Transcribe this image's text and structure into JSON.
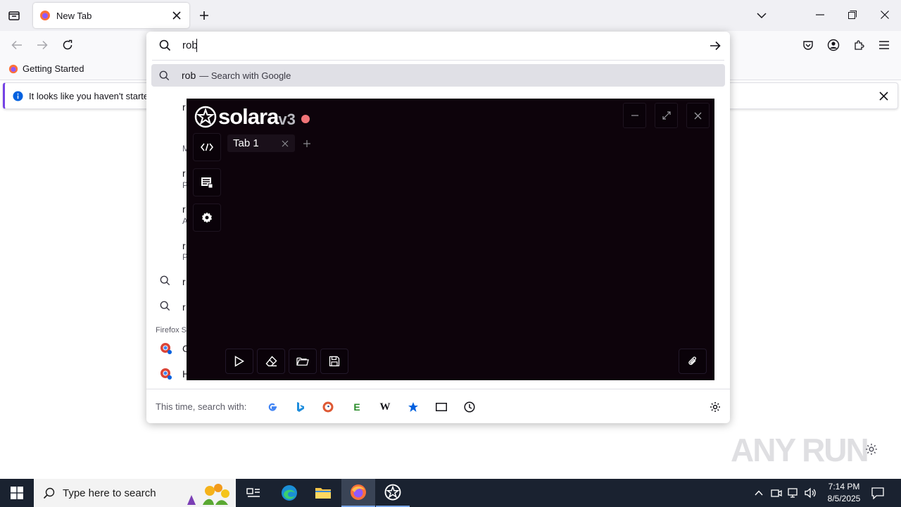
{
  "browser": {
    "tab_title": "New Tab",
    "bookmark_item": "Getting Started",
    "notification": "It looks like you haven't started"
  },
  "urlbar": {
    "value": "rob",
    "highlighted_query": "rob",
    "highlighted_suffix": "— Search with Google",
    "partial_rows": [
      "r",
      "M",
      "r",
      "P",
      "r",
      "A",
      "r",
      "P",
      "r",
      "r"
    ],
    "firefox_suggest_partial": "Firefox S",
    "bottom_partial_rows": [
      "G",
      "H"
    ],
    "search_with_label": "This time, search with:",
    "engines": [
      "google",
      "bing",
      "duckduckgo",
      "ebay",
      "wikipedia",
      "bookmarks",
      "tabs",
      "history"
    ]
  },
  "solara": {
    "name": "solara",
    "version": "v3",
    "tab_label": "Tab 1",
    "accent_dot": "#f07478"
  },
  "watermark": "ANY RUN",
  "taskbar": {
    "search_placeholder": "Type here to search",
    "time": "7:14 PM",
    "date": "8/5/2025"
  }
}
